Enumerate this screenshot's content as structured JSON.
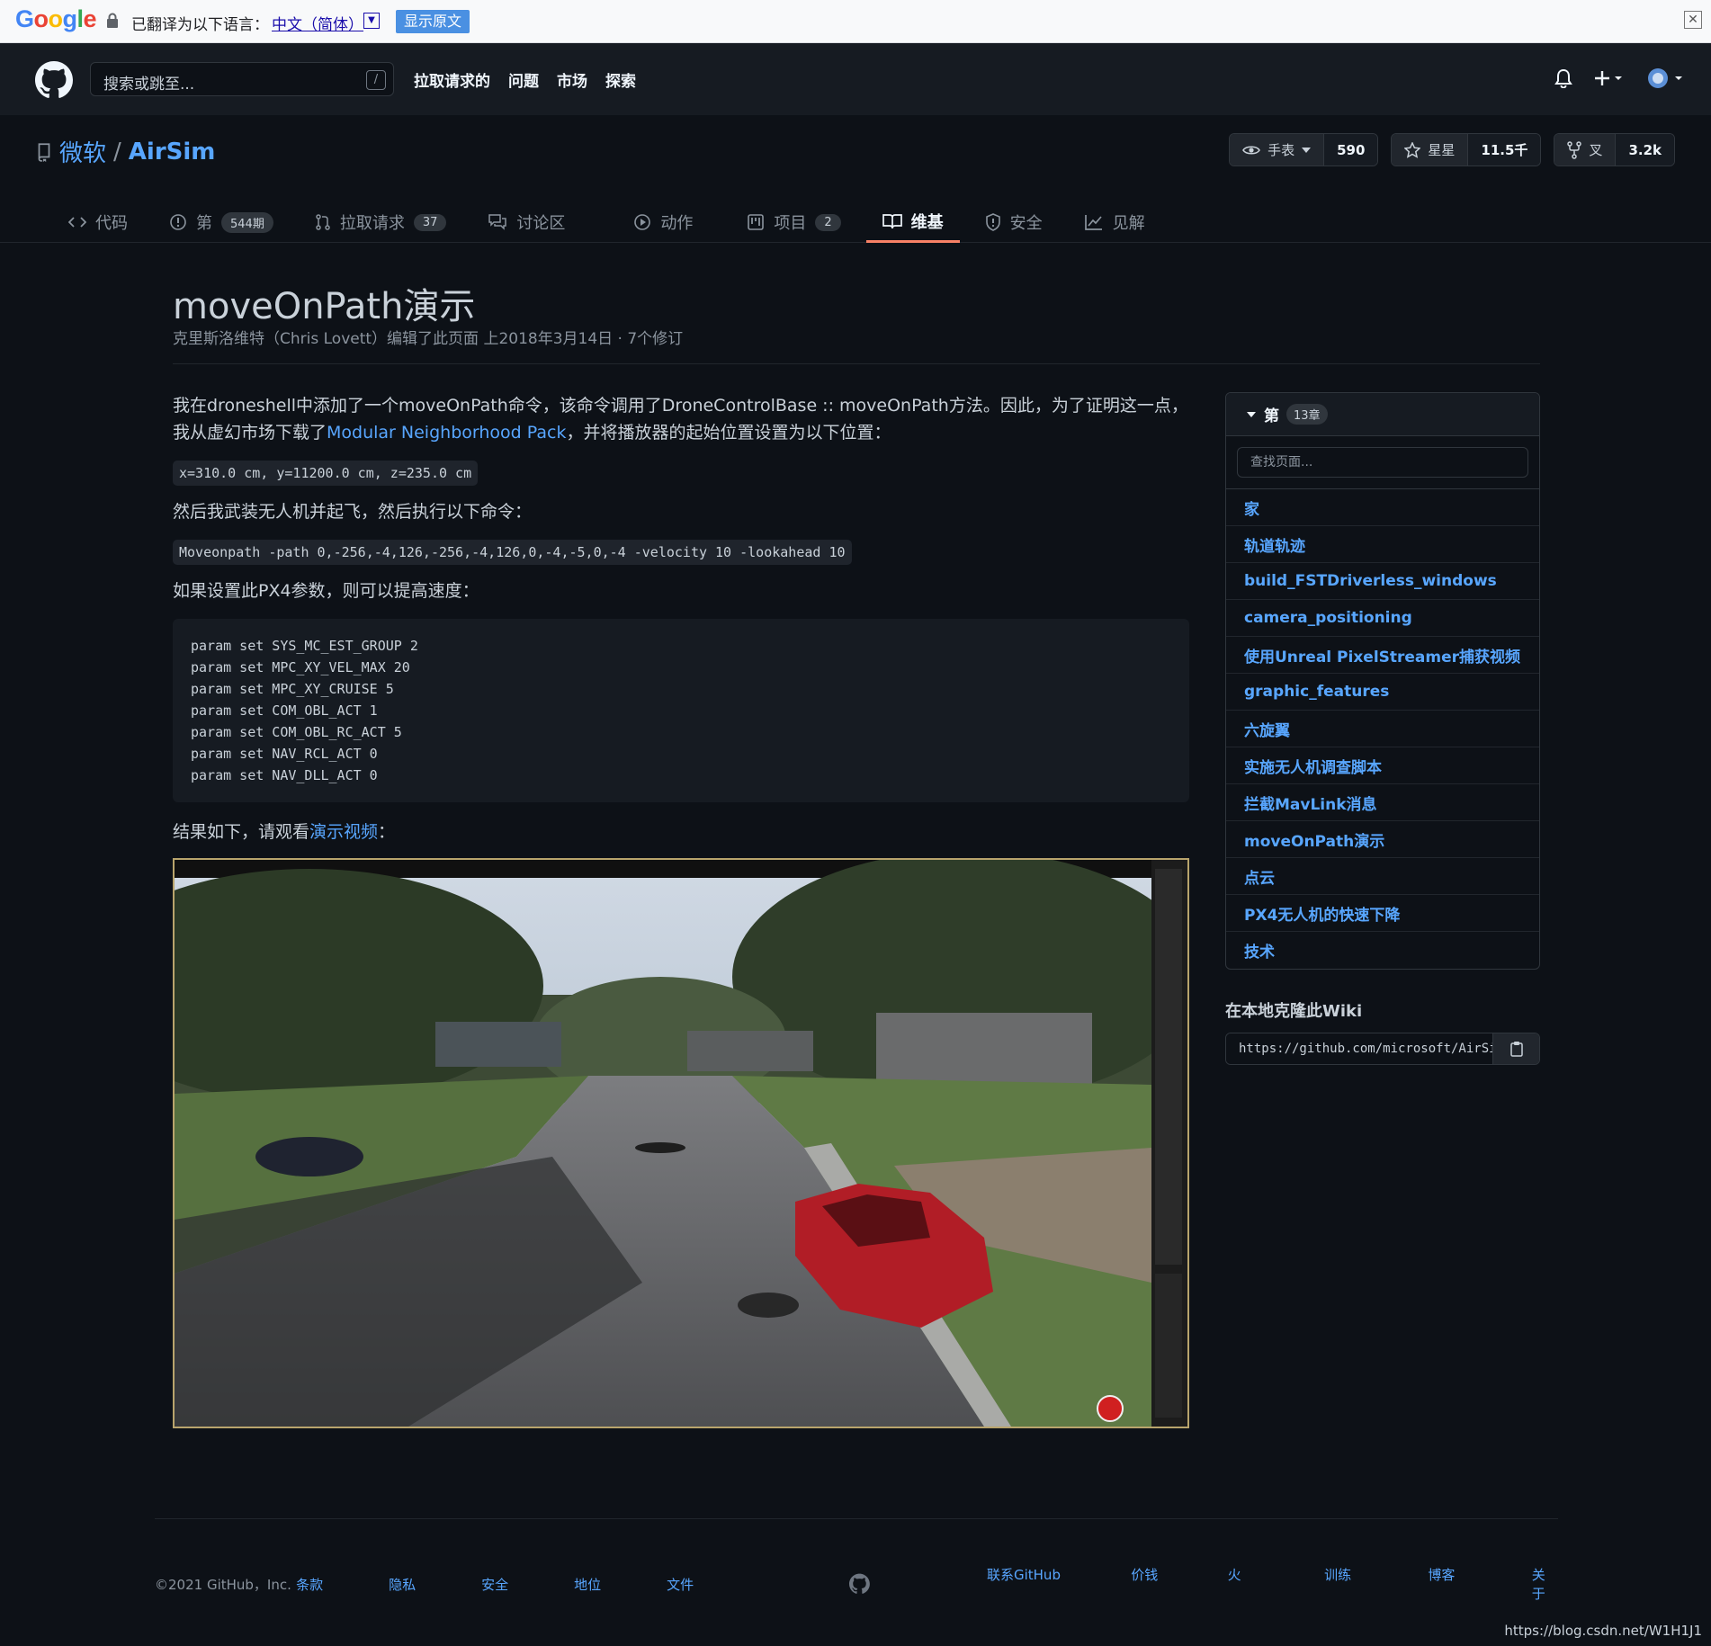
{
  "translate_bar": {
    "prefix": "已翻译为以下语言：",
    "language": "中文（简体）",
    "show_original": "显示原文"
  },
  "header": {
    "search_placeholder": "搜索或跳至...",
    "search_shortcut": "/",
    "nav": [
      "拉取请求的",
      "问题",
      "市场",
      "探索"
    ]
  },
  "repo": {
    "owner": "微软",
    "name": "AirSim",
    "watch_label": "手表",
    "watch_count": "590",
    "star_label": "星星",
    "star_count": "11.5千",
    "fork_label": "叉",
    "fork_count": "3.2k",
    "tabs": [
      {
        "label": "代码",
        "count": ""
      },
      {
        "label": "第",
        "count": "544期"
      },
      {
        "label": "拉取请求",
        "count": "37"
      },
      {
        "label": "讨论区",
        "count": ""
      },
      {
        "label": "动作",
        "count": ""
      },
      {
        "label": "项目",
        "count": "2"
      },
      {
        "label": "维基",
        "count": ""
      },
      {
        "label": "安全",
        "count": ""
      },
      {
        "label": "见解",
        "count": ""
      }
    ]
  },
  "page": {
    "title": "moveOnPath演示",
    "meta": "克里斯洛维特（Chris Lovett）编辑了此页面 上2018年3月14日 · 7个修订",
    "p1_part1": "我在droneshell中添加了一个moveOnPath命令，该命令调用了DroneControlBase :: moveOnPath方法。因此，为了证明这一点，我从虚幻市场下载了",
    "p1_link": "Modular Neighborhood Pack",
    "p1_part2": "，并将播放器的起始位置设置为以下位置：",
    "code1": "x=310.0 cm, y=11200.0 cm, z=235.0 cm",
    "p2": "然后我武装无人机并起飞，然后执行以下命令：",
    "code2": "Moveonpath -path 0,-256,-4,126,-256,-4,126,0,-4,-5,0,-4 -velocity 10 -lookahead 10",
    "p3": "如果设置此PX4参数，则可以提高速度：",
    "code_block": [
      "param set SYS_MC_EST_GROUP 2",
      "param set MPC_XY_VEL_MAX 20",
      "param set MPC_XY_CRUISE 5",
      "param set COM_OBL_ACT 1",
      "param set COM_OBL_RC_ACT 5",
      "param set NAV_RCL_ACT 0",
      "param set NAV_DLL_ACT 0"
    ],
    "p4_part1": "结果如下，请观看",
    "p4_link": "演示视频",
    "p4_part2": "："
  },
  "sidebar": {
    "pages_label": "第",
    "pages_count": "13章",
    "search_placeholder": "查找页面...",
    "pages": [
      "家",
      "轨道轨迹",
      "build_FSTDriverless_windows",
      "camera_positioning",
      "使用Unreal PixelStreamer捕获视频",
      "graphic_features",
      "六旋翼",
      "实施无人机调查脚本",
      "拦截MavLink消息",
      "moveOnPath演示",
      "点云",
      "PX4无人机的快速下降",
      "技术"
    ],
    "clone_title": "在本地克隆此Wiki",
    "clone_url": "https://github.com/microsoft/AirSim.wiki.git"
  },
  "footer": {
    "copyright": "©2021 GitHub，Inc.",
    "left_links": [
      "条款",
      "隐私",
      "安全",
      "地位",
      "文件"
    ],
    "right_links": [
      "联系GitHub",
      "价钱",
      "火",
      "训练",
      "博客",
      "关于"
    ]
  },
  "watermark": "https://blog.csdn.net/W1H1J1",
  "colors": {
    "background": "#0d1117",
    "header": "#161b22",
    "link": "#58a6ff",
    "active_tab_underline": "#f78166"
  }
}
